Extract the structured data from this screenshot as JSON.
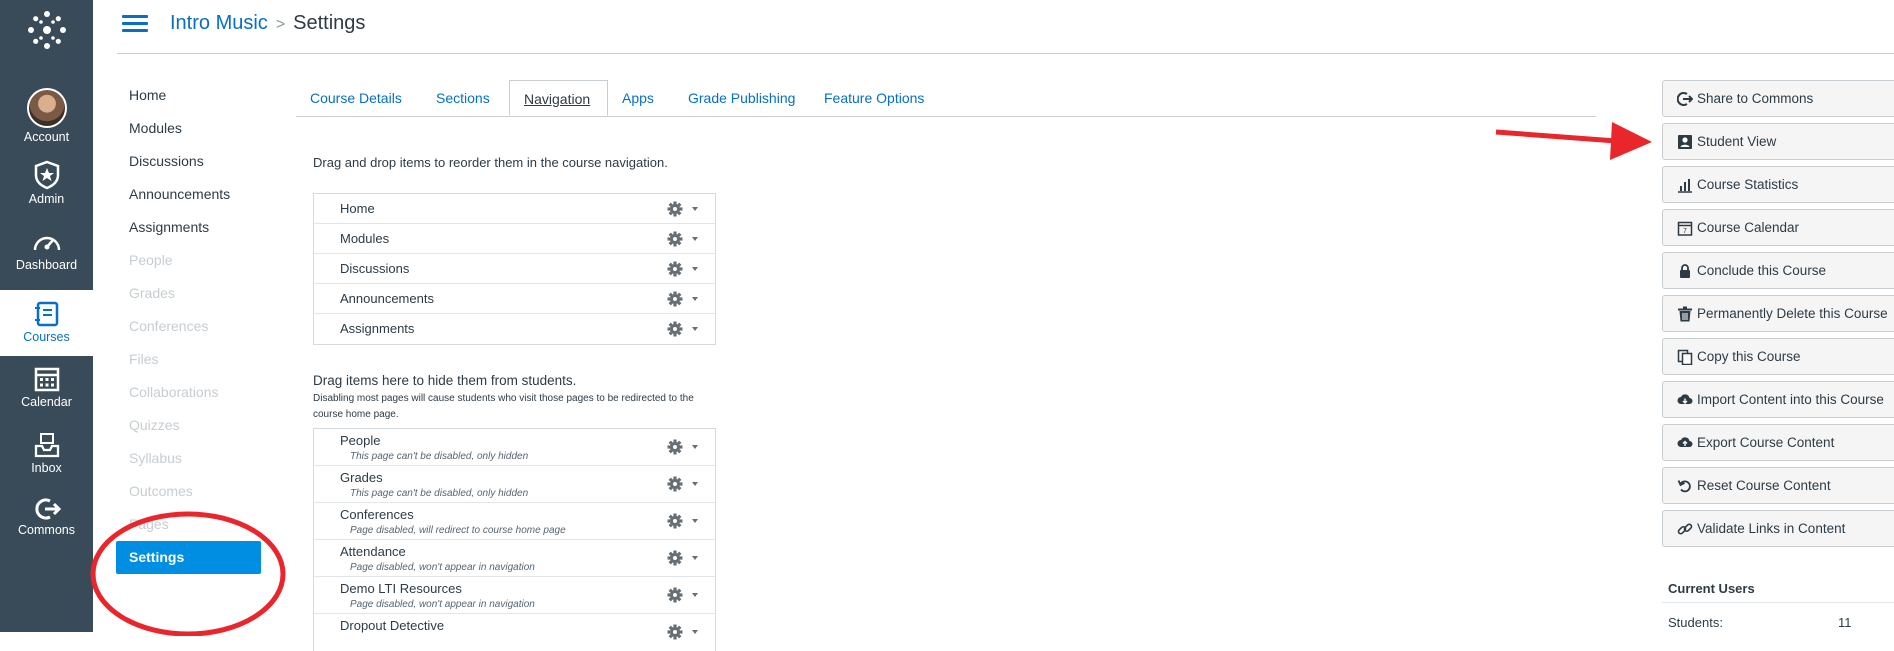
{
  "global_nav": {
    "items": [
      {
        "label": "Account",
        "icon": "avatar"
      },
      {
        "label": "Admin",
        "icon": "shield-star-icon"
      },
      {
        "label": "Dashboard",
        "icon": "gauge-icon"
      },
      {
        "label": "Courses",
        "icon": "book-icon",
        "active": true
      },
      {
        "label": "Calendar",
        "icon": "calendar-icon"
      },
      {
        "label": "Inbox",
        "icon": "inbox-icon"
      },
      {
        "label": "Commons",
        "icon": "commons-icon"
      }
    ]
  },
  "breadcrumb": {
    "course": "Intro Music",
    "separator": ">",
    "page": "Settings"
  },
  "course_nav": {
    "items": [
      {
        "label": "Home",
        "disabled": false
      },
      {
        "label": "Modules",
        "disabled": false
      },
      {
        "label": "Discussions",
        "disabled": false
      },
      {
        "label": "Announcements",
        "disabled": false
      },
      {
        "label": "Assignments",
        "disabled": false
      },
      {
        "label": "People",
        "disabled": true
      },
      {
        "label": "Grades",
        "disabled": true
      },
      {
        "label": "Conferences",
        "disabled": true
      },
      {
        "label": "Files",
        "disabled": true
      },
      {
        "label": "Collaborations",
        "disabled": true
      },
      {
        "label": "Quizzes",
        "disabled": true
      },
      {
        "label": "Syllabus",
        "disabled": true
      },
      {
        "label": "Outcomes",
        "disabled": true
      },
      {
        "label": "Pages",
        "disabled": true
      }
    ],
    "active": "Settings"
  },
  "tabs": [
    "Course Details",
    "Sections",
    "Navigation",
    "Apps",
    "Grade Publishing",
    "Feature Options"
  ],
  "active_tab": "Navigation",
  "navigation": {
    "reorder_instruction": "Drag and drop items to reorder them in the course navigation.",
    "enabled_items": [
      "Home",
      "Modules",
      "Discussions",
      "Announcements",
      "Assignments"
    ],
    "hide_instruction": "Drag items here to hide them from students.",
    "hide_note": "Disabling most pages will cause students who visit those pages to be redirected to the course home page.",
    "hidden_items": [
      {
        "label": "People",
        "note": "This page can't be disabled, only hidden"
      },
      {
        "label": "Grades",
        "note": "This page can't be disabled, only hidden"
      },
      {
        "label": "Conferences",
        "note": "Page disabled, will redirect to course home page"
      },
      {
        "label": "Attendance",
        "note": "Page disabled, won't appear in navigation"
      },
      {
        "label": "Demo LTI Resources",
        "note": "Page disabled, won't appear in navigation"
      },
      {
        "label": "Dropout Detective",
        "note": ""
      }
    ]
  },
  "sidebar": {
    "buttons": [
      {
        "label": "Share to Commons",
        "icon": "share-icon"
      },
      {
        "label": "Student View",
        "icon": "student-view-icon"
      },
      {
        "label": "Course Statistics",
        "icon": "statistics-icon"
      },
      {
        "label": "Course Calendar",
        "icon": "calendar-icon"
      },
      {
        "label": "Conclude this Course",
        "icon": "lock-icon"
      },
      {
        "label": "Permanently Delete this Course",
        "icon": "trash-icon"
      },
      {
        "label": "Copy this Course",
        "icon": "copy-icon"
      },
      {
        "label": "Import Content into this Course",
        "icon": "cloud-download-icon"
      },
      {
        "label": "Export Course Content",
        "icon": "cloud-upload-icon"
      },
      {
        "label": "Reset Course Content",
        "icon": "reset-icon"
      },
      {
        "label": "Validate Links in Content",
        "icon": "link-icon"
      }
    ],
    "current_users": {
      "title": "Current Users",
      "students_label": "Students:",
      "students_count": "11"
    }
  },
  "colors": {
    "brand": "#0770c4",
    "active_nav": "#008ee2",
    "nav_bg": "#394b58",
    "annotation": "#e8262b"
  }
}
